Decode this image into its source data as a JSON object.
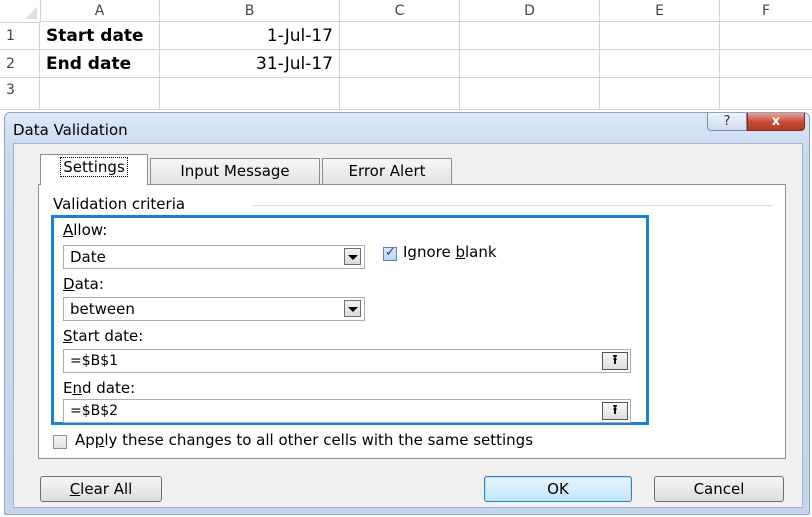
{
  "sheet": {
    "columns": [
      "A",
      "B",
      "C",
      "D",
      "E",
      "F"
    ],
    "rows": [
      {
        "num": "1",
        "a": "Start date",
        "b": "1-Jul-17"
      },
      {
        "num": "2",
        "a": "End date",
        "b": "31-Jul-17"
      },
      {
        "num": "3",
        "a": "",
        "b": ""
      }
    ]
  },
  "dialog": {
    "title": "Data Validation",
    "help_glyph": "?",
    "close_glyph": "x",
    "tabs": [
      "Settings",
      "Input Message",
      "Error Alert"
    ],
    "group_title": "Validation criteria",
    "allow": {
      "label_pre": "",
      "label_u": "A",
      "label_post": "llow:",
      "value": "Date"
    },
    "ignore_blank": {
      "label_pre": "Ignore ",
      "label_u": "b",
      "label_post": "lank",
      "checked": true
    },
    "data": {
      "label_pre": "",
      "label_u": "D",
      "label_post": "ata:",
      "value": "between"
    },
    "start_date": {
      "label_pre": "",
      "label_u": "S",
      "label_post": "tart date:",
      "value": "=$B$1"
    },
    "end_date": {
      "label_pre": "E",
      "label_u": "n",
      "label_post": "d date:",
      "value": "=$B$2"
    },
    "apply_all": {
      "label_pre": "Ap",
      "label_u": "p",
      "label_post": "ly these changes to all other cells with the same settings",
      "checked": false
    },
    "ref_glyph": "⭱",
    "buttons": {
      "clear_u": "C",
      "clear_rest": "lear All",
      "ok": "OK",
      "cancel": "Cancel"
    }
  },
  "colors": {
    "accent": "#1e7fd6",
    "close": "#c24a34",
    "titlebar": "#c8daee"
  }
}
